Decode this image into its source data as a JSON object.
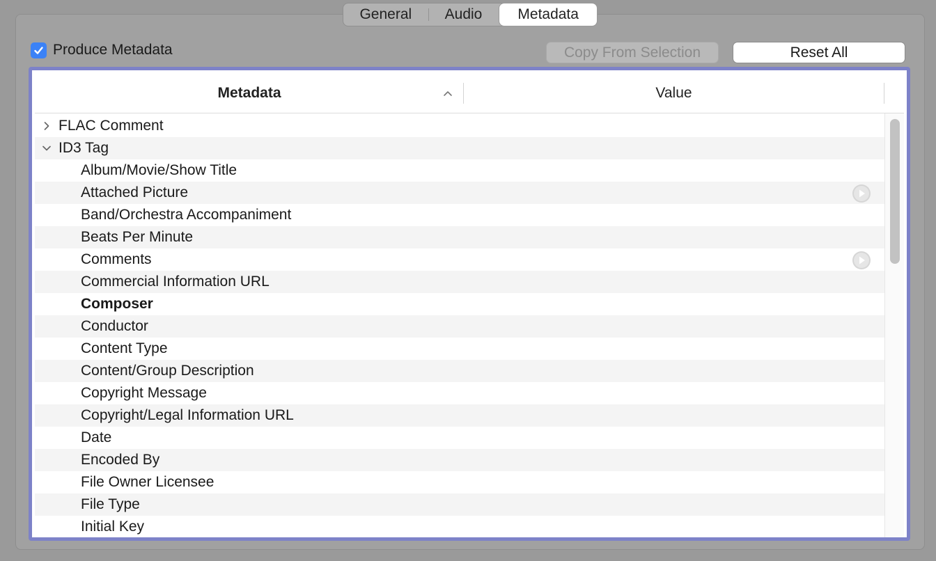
{
  "tabs": [
    {
      "label": "General",
      "selected": false
    },
    {
      "label": "Audio",
      "selected": false
    },
    {
      "label": "Metadata",
      "selected": true
    }
  ],
  "produce_metadata": {
    "label": "Produce Metadata",
    "checked": true
  },
  "buttons": {
    "copy_from_selection": "Copy From Selection",
    "reset_all": "Reset All"
  },
  "table": {
    "columns": {
      "metadata": "Metadata",
      "value": "Value"
    },
    "sort": "ascending",
    "rows": [
      {
        "label": "FLAC Comment",
        "type": "group",
        "expanded": false
      },
      {
        "label": "ID3 Tag",
        "type": "group",
        "expanded": true
      },
      {
        "label": "Album/Movie/Show Title",
        "type": "child"
      },
      {
        "label": "Attached Picture",
        "type": "child",
        "action": "play-circle-icon"
      },
      {
        "label": "Band/Orchestra Accompaniment",
        "type": "child"
      },
      {
        "label": "Beats Per Minute",
        "type": "child"
      },
      {
        "label": "Comments",
        "type": "child",
        "action": "play-circle-icon"
      },
      {
        "label": "Commercial Information URL",
        "type": "child"
      },
      {
        "label": "Composer",
        "type": "child",
        "bold": true
      },
      {
        "label": "Conductor",
        "type": "child"
      },
      {
        "label": "Content Type",
        "type": "child"
      },
      {
        "label": "Content/Group Description",
        "type": "child"
      },
      {
        "label": "Copyright Message",
        "type": "child"
      },
      {
        "label": "Copyright/Legal Information URL",
        "type": "child"
      },
      {
        "label": "Date",
        "type": "child"
      },
      {
        "label": "Encoded By",
        "type": "child"
      },
      {
        "label": "File Owner Licensee",
        "type": "child"
      },
      {
        "label": "File Type",
        "type": "child"
      },
      {
        "label": "Initial Key",
        "type": "child"
      }
    ]
  },
  "colors": {
    "accent": "#3b82f6",
    "focus_ring": "#7d82c8",
    "row_alt": "#f4f4f4",
    "window_bg": "#9a9a9a"
  }
}
